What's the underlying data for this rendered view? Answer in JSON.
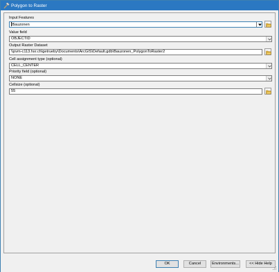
{
  "window": {
    "title": "Polygon to Raster"
  },
  "fields": {
    "input_features": {
      "label": "Input Features",
      "value": "Bauzonen"
    },
    "value_field": {
      "label": "Value field",
      "value": "OBJECTID"
    },
    "output_raster": {
      "label": "Output Raster Dataset",
      "value": "\\\\pvm-c113.hsr.ch\\getrueby\\Documents\\ArcGIS\\Default.gdb\\Bauzonen_PolygonToRaster2"
    },
    "cell_assignment": {
      "label": "Cell assignment type (optional)",
      "value": "CELL_CENTER"
    },
    "priority_field": {
      "label": "Priority field (optional)",
      "value": "NONE"
    },
    "cellsize": {
      "label": "Cellsize (optional)",
      "value": "55"
    }
  },
  "buttons": {
    "ok": "OK",
    "cancel": "Cancel",
    "environments": "Environments...",
    "hide_help": "<< Hide Help"
  },
  "colors": {
    "titlebar": "#2b78c2",
    "folder": "#e8b93a"
  }
}
